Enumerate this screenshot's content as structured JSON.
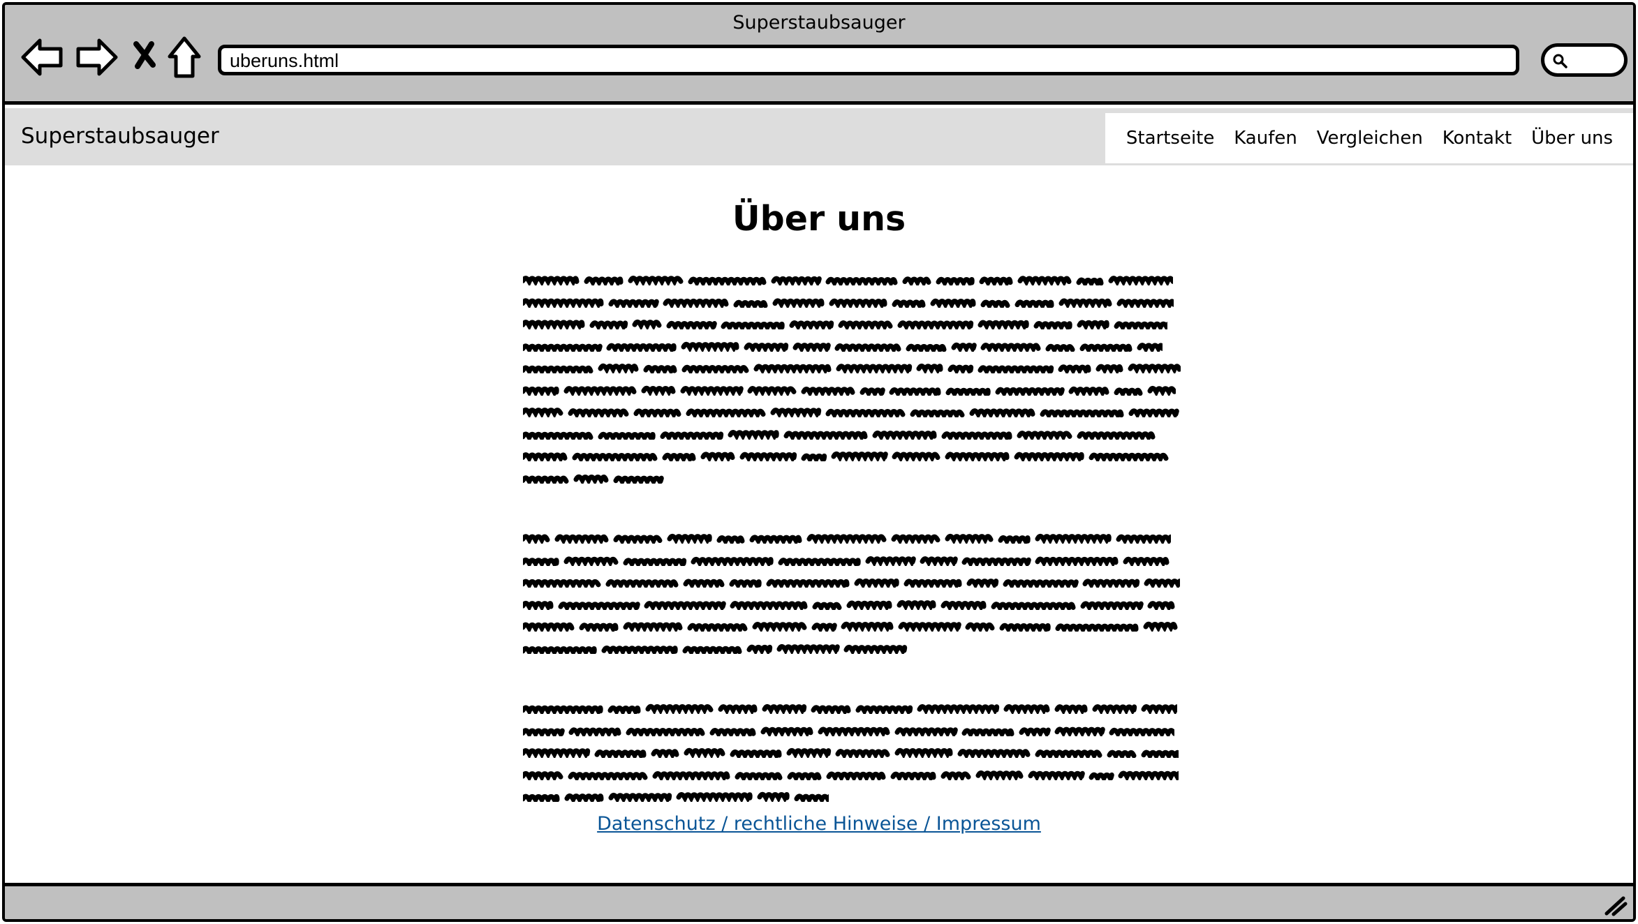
{
  "browser": {
    "window_title": "Superstaubsauger",
    "address": "uberuns.html",
    "icons": {
      "back": "arrow-left-icon",
      "forward": "arrow-right-icon",
      "stop": "close-icon",
      "home": "home-icon",
      "search": "search-icon",
      "resize": "resize-grip-icon"
    }
  },
  "site": {
    "logo": "Superstaubsauger",
    "nav": [
      "Startseite",
      "Kaufen",
      "Vergleichen",
      "Kontakt",
      "Über uns"
    ]
  },
  "main": {
    "heading": "Über uns",
    "paragraphs_line_counts": [
      10,
      6,
      5
    ],
    "footer_link": "Datenschutz / rechtliche Hinweise / Impressum"
  },
  "colors": {
    "chrome": "#c0c0c0",
    "header": "#dddddd",
    "link": "#0a5596"
  }
}
